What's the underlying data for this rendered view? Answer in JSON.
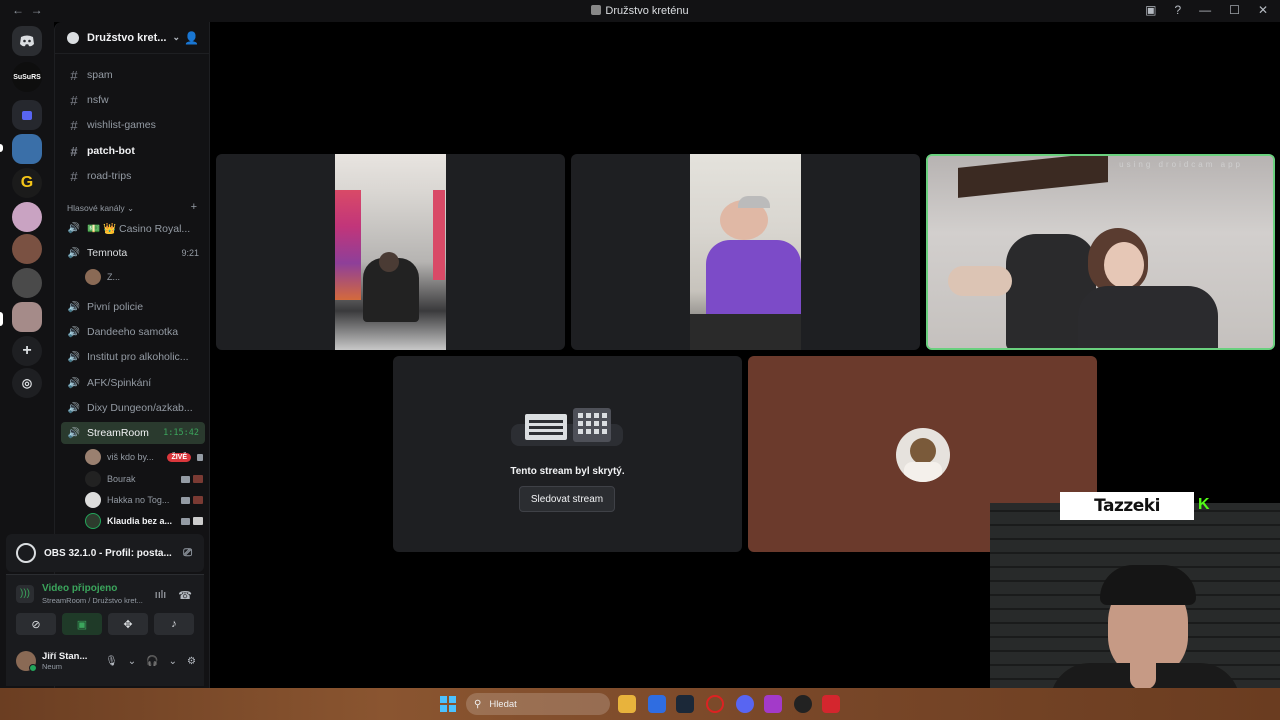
{
  "window": {
    "title": "Družstvo kreténu"
  },
  "servers": [
    {
      "name": "Discord",
      "label": ""
    },
    {
      "name": "SuSuRS",
      "label": "SuSuRS"
    },
    {
      "name": "folder",
      "label": ""
    },
    {
      "name": "server-a",
      "label": ""
    },
    {
      "name": "server-g",
      "label": "G"
    },
    {
      "name": "server-c",
      "label": ""
    },
    {
      "name": "server-d",
      "label": ""
    },
    {
      "name": "server-e",
      "label": ""
    },
    {
      "name": "server-f",
      "label": ""
    }
  ],
  "guild": {
    "name": "Družstvo kret..."
  },
  "text_channels": [
    {
      "name": "spam"
    },
    {
      "name": "nsfw"
    },
    {
      "name": "wishlist-games"
    },
    {
      "name": "patch-bot"
    },
    {
      "name": "road-trips"
    }
  ],
  "voice_category": "Hlasové kanály",
  "voice_channels": [
    {
      "name": "💵 👑 Casino Royal..."
    },
    {
      "name": "Temnota",
      "time": "9:21"
    },
    {
      "name": "Pivní policie"
    },
    {
      "name": "Dandeeho samotka"
    },
    {
      "name": "Institut pro alkoholic..."
    },
    {
      "name": "AFK/Spinkání"
    },
    {
      "name": "Dixy Dungeon/azkab..."
    },
    {
      "name": "StreamRoom",
      "time": "1:15:42"
    }
  ],
  "temnota_member": "Z...",
  "stream_members": [
    {
      "name": "viš kdo by...",
      "live": "ŽIVĚ"
    },
    {
      "name": "Bourak"
    },
    {
      "name": "Hakka no Tog..."
    },
    {
      "name": "Klaudia bez a..."
    }
  ],
  "obs": {
    "label": "OBS 32.1.0 - Profil: posta..."
  },
  "voice_status": {
    "title": "Video připojeno",
    "subtitle": "StreamRoom / Družstvo kret..."
  },
  "user": {
    "name": "Jiří Stan...",
    "status": "Neum"
  },
  "stage": {
    "watermark": "using droidcam app",
    "hidden_text": "Tento stream byl skrytý.",
    "watch_button": "Sledovat stream"
  },
  "overlay": {
    "nametag": "Tazzeki",
    "kick_mark": "K"
  },
  "taskbar": {
    "search_placeholder": "Hledat"
  },
  "colors": {
    "accent_green": "#23a55a",
    "live_red": "#da373c",
    "profile_tile": "#6b3a2c"
  }
}
